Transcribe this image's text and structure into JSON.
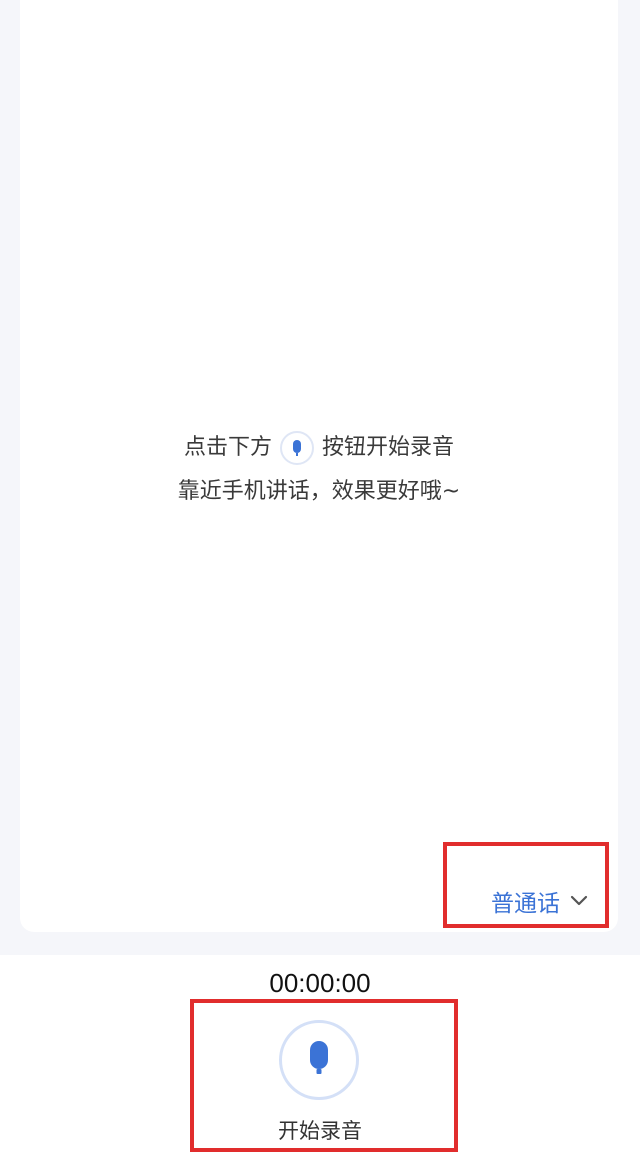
{
  "hint": {
    "line1_before": "点击下方",
    "line1_after": "按钮开始录音",
    "line2": "靠近手机讲话，效果更好哦~"
  },
  "language_selector": {
    "label": "普通话",
    "icon": "chevron-down-icon"
  },
  "recorder": {
    "timer": "00:00:00",
    "button_label": "开始录音",
    "icon": "microphone-icon"
  },
  "colors": {
    "accent": "#3b73d6",
    "highlight_box": "#e12d2d",
    "background": "#f5f6fa"
  }
}
